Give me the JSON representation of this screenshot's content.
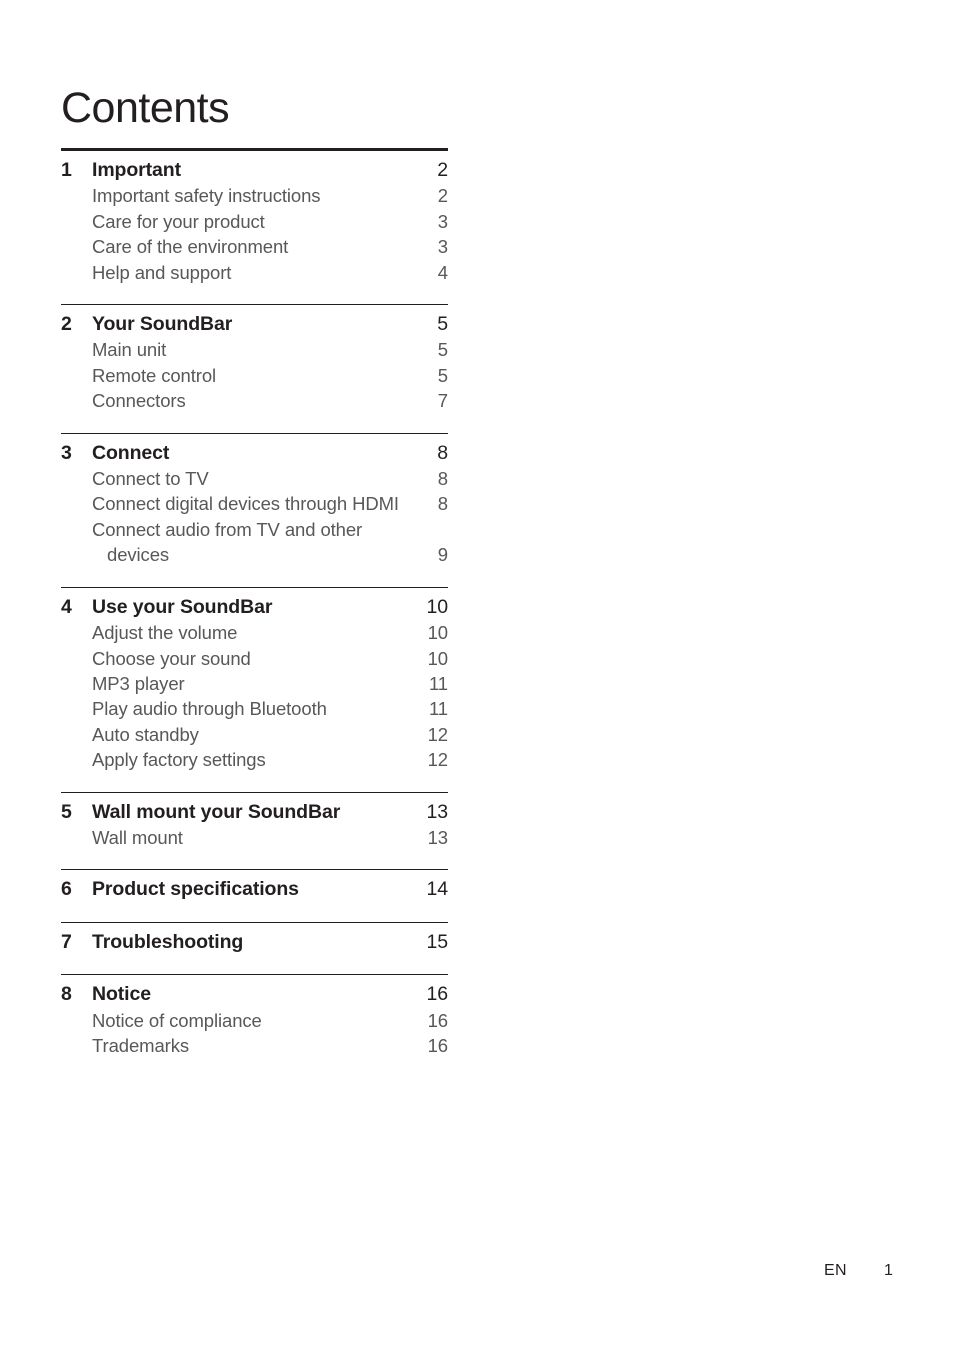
{
  "document": {
    "title": "Contents"
  },
  "toc": {
    "sections": [
      {
        "number": "1",
        "title": "Important",
        "page": "2",
        "rule": "thick",
        "entries": [
          {
            "label": "Important safety instructions",
            "page": "2"
          },
          {
            "label": "Care for your product",
            "page": "3"
          },
          {
            "label": "Care of the environment",
            "page": "3"
          },
          {
            "label": "Help and support",
            "page": "4"
          }
        ]
      },
      {
        "number": "2",
        "title": "Your SoundBar",
        "page": "5",
        "rule": "thin",
        "entries": [
          {
            "label": "Main unit",
            "page": "5"
          },
          {
            "label": "Remote control",
            "page": "5"
          },
          {
            "label": "Connectors",
            "page": "7"
          }
        ]
      },
      {
        "number": "3",
        "title": "Connect",
        "page": "8",
        "rule": "thin",
        "entries": [
          {
            "label": "Connect to TV",
            "page": "8"
          },
          {
            "label": "Connect digital devices through HDMI",
            "page": "8"
          },
          {
            "label": "Connect audio from TV and other",
            "page": ""
          },
          {
            "label": "devices",
            "page": "9",
            "continuation": true
          }
        ]
      },
      {
        "number": "4",
        "title": "Use your SoundBar",
        "page": "10",
        "rule": "thin",
        "entries": [
          {
            "label": "Adjust the volume",
            "page": "10"
          },
          {
            "label": "Choose your sound",
            "page": "10"
          },
          {
            "label": "MP3 player",
            "page": "11"
          },
          {
            "label": "Play audio through Bluetooth",
            "page": "11"
          },
          {
            "label": "Auto standby",
            "page": "12"
          },
          {
            "label": "Apply factory settings",
            "page": "12"
          }
        ]
      },
      {
        "number": "5",
        "title": "Wall mount your SoundBar",
        "page": "13",
        "rule": "thin",
        "entries": [
          {
            "label": "Wall mount",
            "page": "13"
          }
        ]
      },
      {
        "number": "6",
        "title": "Product specifications",
        "page": "14",
        "rule": "thin",
        "entries": []
      },
      {
        "number": "7",
        "title": "Troubleshooting",
        "page": "15",
        "rule": "thin",
        "entries": []
      },
      {
        "number": "8",
        "title": "Notice",
        "page": "16",
        "rule": "thin",
        "entries": [
          {
            "label": "Notice of compliance",
            "page": "16"
          },
          {
            "label": "Trademarks",
            "page": "16"
          }
        ]
      }
    ]
  },
  "footer": {
    "language": "EN",
    "page_number": "1"
  }
}
